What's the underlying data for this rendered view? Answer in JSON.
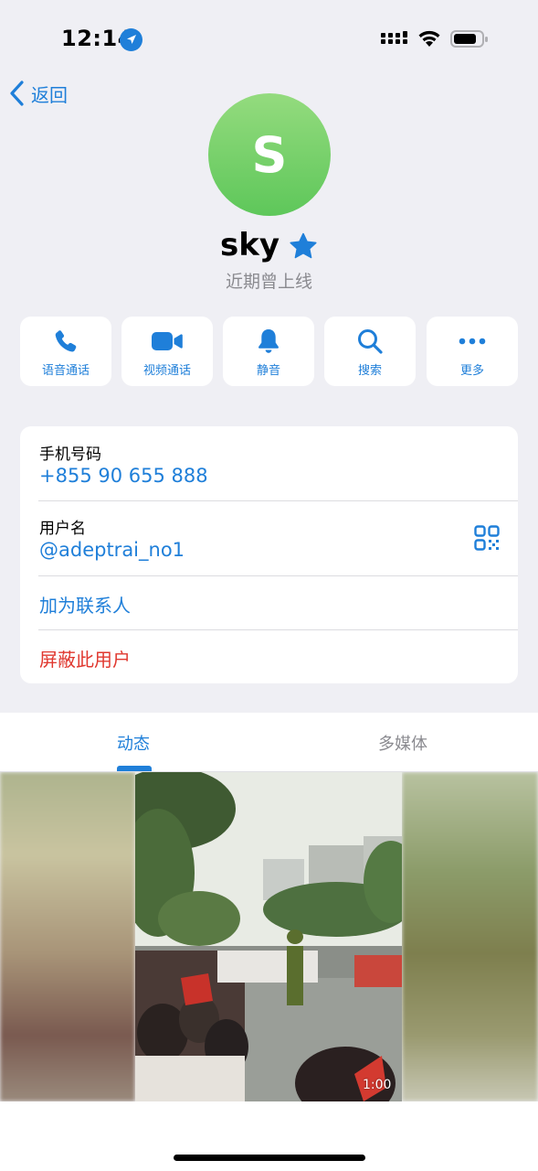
{
  "status_bar": {
    "time": "12:14"
  },
  "nav": {
    "back_label": "返回"
  },
  "profile": {
    "avatar_letter": "S",
    "name": "sky",
    "last_seen": "近期曾上线"
  },
  "actions": [
    {
      "label": "语音通话",
      "icon": "phone-icon"
    },
    {
      "label": "视频通话",
      "icon": "video-icon"
    },
    {
      "label": "静音",
      "icon": "bell-icon"
    },
    {
      "label": "搜索",
      "icon": "search-icon"
    },
    {
      "label": "更多",
      "icon": "more-icon"
    }
  ],
  "info": {
    "phone_label": "手机号码",
    "phone_value": "+855 90 655 888",
    "username_label": "用户名",
    "username_value": "@adeptrai_no1",
    "add_contact": "加为联系人",
    "block_user": "屏蔽此用户"
  },
  "tabs": [
    {
      "label": "动态",
      "active": true
    },
    {
      "label": "多媒体",
      "active": false
    }
  ],
  "media": {
    "duration": "1:00"
  },
  "colors": {
    "accent": "#1f7fd9",
    "danger": "#e0382f",
    "avatar": "#6fcf63",
    "background": "#efeff4"
  }
}
